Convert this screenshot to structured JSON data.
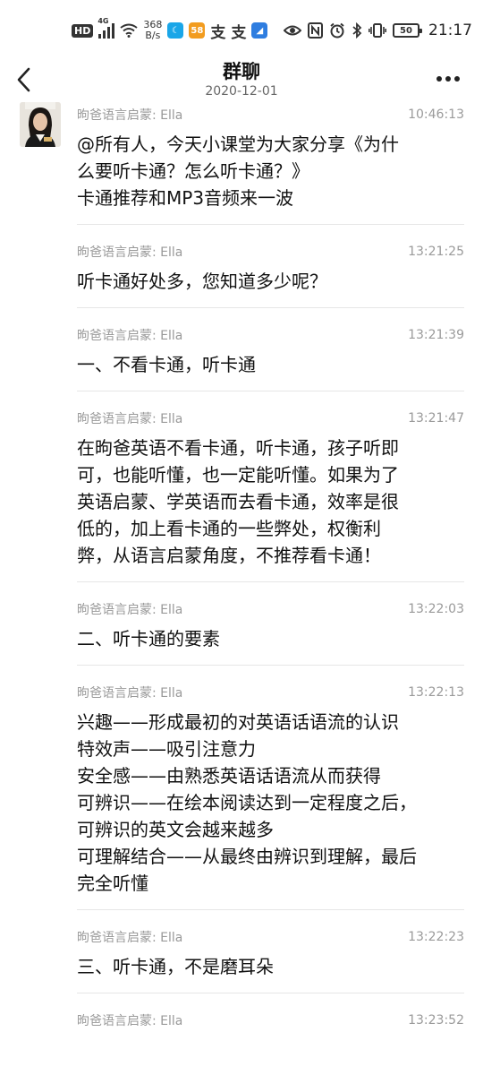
{
  "status_bar": {
    "hd": "HD",
    "network": "4G",
    "speed_value": "368",
    "speed_unit": "B/s",
    "app_58": "58",
    "battery": "50",
    "time": "21:17",
    "icons": [
      "hd-icon",
      "signal-icon",
      "wifi-icon",
      "app-icon",
      "58-app-icon",
      "alipay-icon",
      "alipay-icon",
      "app-icon",
      "eye-icon",
      "nfc-icon",
      "alarm-icon",
      "bluetooth-icon",
      "vibrate-icon",
      "battery-icon"
    ]
  },
  "header": {
    "title": "群聊",
    "date": "2020-12-01"
  },
  "messages": [
    {
      "sender": "昫爸语言启蒙: Ella",
      "time": "10:46:13",
      "lines": [
        "@所有人，今天小课堂为大家分享《为什",
        "么要听卡通？怎么听卡通？》",
        "卡通推荐和MP3音频来一波"
      ]
    },
    {
      "sender": "昫爸语言启蒙: Ella",
      "time": "13:21:25",
      "lines": [
        "听卡通好处多，您知道多少呢？"
      ]
    },
    {
      "sender": "昫爸语言启蒙: Ella",
      "time": "13:21:39",
      "lines": [
        "一、不看卡通，听卡通"
      ]
    },
    {
      "sender": "昫爸语言启蒙: Ella",
      "time": "13:21:47",
      "lines": [
        "在昫爸英语不看卡通，听卡通，孩子听即",
        "可，也能听懂，也一定能听懂。如果为了",
        "英语启蒙、学英语而去看卡通，效率是很",
        "低的，加上看卡通的一些弊处，权衡利",
        "弊，从语言启蒙角度，不推荐看卡通！"
      ]
    },
    {
      "sender": "昫爸语言启蒙: Ella",
      "time": "13:22:03",
      "lines": [
        "二、听卡通的要素"
      ]
    },
    {
      "sender": "昫爸语言启蒙: Ella",
      "time": "13:22:13",
      "lines": [
        "兴趣——形成最初的对英语话语流的认识",
        "特效声——吸引注意力",
        "安全感——由熟悉英语话语流从而获得",
        "可辨识——在绘本阅读达到一定程度之后，",
        "可辨识的英文会越来越多",
        "可理解结合——从最终由辨识到理解，最后",
        "完全听懂"
      ]
    },
    {
      "sender": "昫爸语言启蒙: Ella",
      "time": "13:22:23",
      "lines": [
        "三、听卡通，不是磨耳朵"
      ]
    },
    {
      "sender": "昫爸语言启蒙: Ella",
      "time": "13:23:52",
      "lines": []
    }
  ]
}
